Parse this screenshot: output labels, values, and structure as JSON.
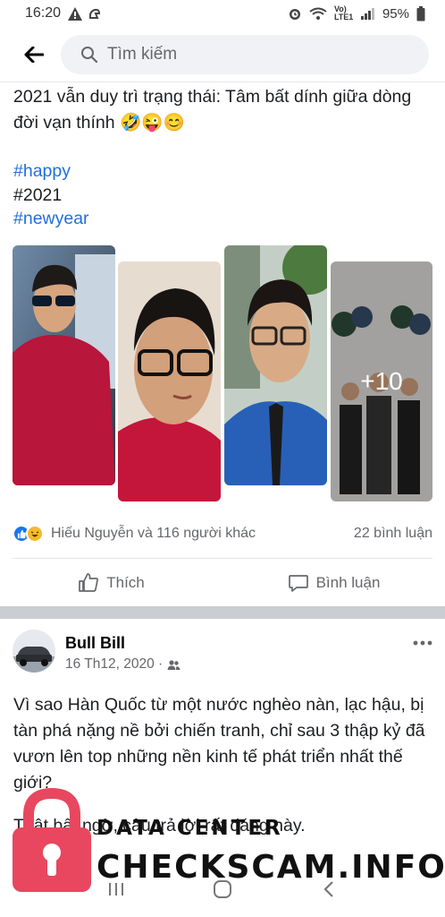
{
  "status_bar": {
    "time": "16:20",
    "network_label": "Vo) LTE1",
    "battery": "95%"
  },
  "search": {
    "placeholder": "Tìm kiếm"
  },
  "post1": {
    "text": "2021 vẫn duy trì trạng thái: Tâm bất dính giữa dòng đời vạn thính 🤣😜😊",
    "hashtags": [
      "#happy",
      "#2021",
      "#newyear"
    ],
    "more_photos": "+10",
    "reactions_text": "Hiếu Nguyễn và 116 người khác",
    "comments_count": "22 bình luận",
    "like_label": "Thích",
    "comment_label": "Bình luận"
  },
  "post2": {
    "author": "Bull Bill",
    "date": "16 Th12, 2020 ·",
    "text": "Vì sao Hàn Quốc từ một nước nghèo nàn, lạc hậu, bị tàn phá nặng nề bởi chiến tranh, chỉ sau 3 thập kỷ đã vươn lên top những nền kinh tế phát triển nhất thế giới?",
    "text_more": "Thật bất ngờ, câu trả lời rất đáng này."
  },
  "watermark": {
    "line1": "DATA CENTER",
    "line2": "CHECKSCAM.INFO"
  },
  "icons": {
    "back": "arrow-left-icon",
    "search": "search-icon",
    "like": "thumbs-up-icon",
    "comment": "comment-icon",
    "audience": "friends-icon",
    "more": "more-horizontal-icon"
  },
  "colors": {
    "hashtag": "#216fdb",
    "meta_text": "#65676b",
    "like_blue": "#1877f2",
    "feed_separator": "#c9ccd1",
    "watermark_lock": "#e8475f"
  }
}
